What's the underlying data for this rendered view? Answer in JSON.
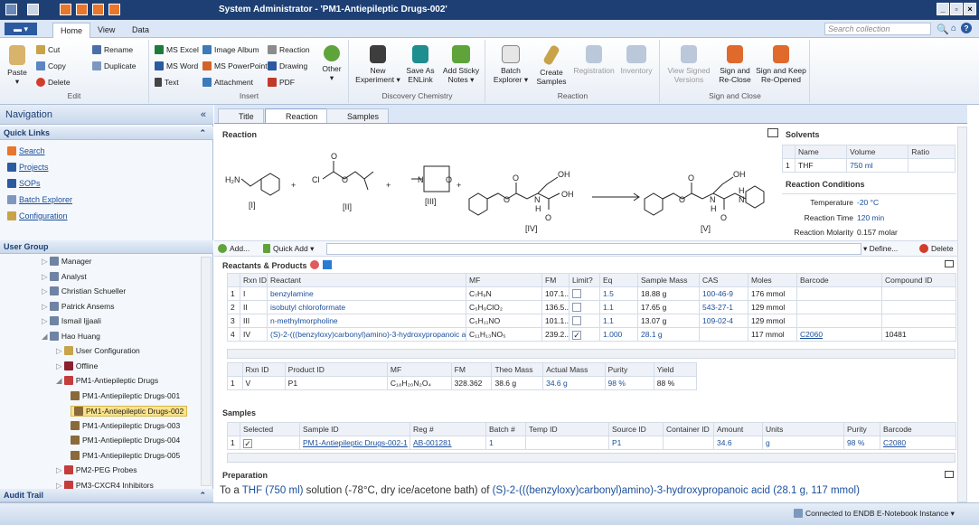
{
  "window": {
    "title": "System Administrator - 'PM1-Antiepileptic Drugs-002'"
  },
  "ribbon_tabs": [
    "Home",
    "View",
    "Data"
  ],
  "search": {
    "placeholder": "Search collection"
  },
  "ribbon": {
    "edit": {
      "paste": "Paste",
      "cut": "Cut",
      "copy": "Copy",
      "delete": "Delete",
      "rename": "Rename",
      "duplicate": "Duplicate",
      "label": "Edit"
    },
    "insert": {
      "ms_excel": "MS Excel",
      "ms_word": "MS Word",
      "text": "Text",
      "image_album": "Image Album",
      "ms_powerpoint": "MS PowerPoint",
      "attachment": "Attachment",
      "reaction": "Reaction",
      "drawing": "Drawing",
      "pdf": "PDF",
      "other": "Other",
      "label": "Insert"
    },
    "discovery": {
      "new_experiment": "New Experiment",
      "save_as": "Save As ENLink",
      "add_sticky": "Add Sticky Notes",
      "label": "Discovery Chemistry"
    },
    "reaction_grp": {
      "batch_explorer": "Batch Explorer",
      "create_samples": "Create Samples",
      "registration": "Registration",
      "inventory": "Inventory",
      "label": "Reaction"
    },
    "sign": {
      "view_signed": "View Signed Versions",
      "sign_reclose": "Sign and Re-Close",
      "sign_keep": "Sign and Keep Re-Opened",
      "label": "Sign and Close"
    }
  },
  "nav": {
    "title": "Navigation",
    "quick_links_title": "Quick Links",
    "quick_links": [
      "Search",
      "Projects",
      "SOPs",
      "Batch Explorer",
      "Configuration"
    ],
    "user_group_title": "User Group",
    "tree": [
      "Manager",
      "Analyst",
      "Christian Schueller",
      "Patrick Ansems",
      "Ismail Ijjaali",
      "Hao Huang",
      "User Configuration",
      "Offline",
      "PM1-Antiepileptic Drugs",
      "PM1-Antiepileptic Drugs-001",
      "PM1-Antiepileptic Drugs-002",
      "PM1-Antiepileptic Drugs-003",
      "PM1-Antiepileptic Drugs-004",
      "PM1-Antiepileptic Drugs-005",
      "PM2-PEG Probes",
      "PM3-CXCR4 Inhibitors"
    ],
    "audit_trail": "Audit Trail"
  },
  "doc_tabs": [
    "Title",
    "Reaction",
    "Samples"
  ],
  "reaction": {
    "section": "Reaction",
    "labels": [
      "[I]",
      "[II]",
      "[III]",
      "[IV]",
      "[V]"
    ],
    "atoms": {
      "h2n": "H₂N",
      "cl": "Cl",
      "o": "O",
      "n": "N",
      "h": "H",
      "oh": "OH"
    }
  },
  "solvents": {
    "title": "Solvents",
    "headers": [
      "Name",
      "Volume",
      "Ratio"
    ],
    "rows": [
      [
        "1",
        "THF",
        "750 ml",
        ""
      ]
    ]
  },
  "conditions": {
    "title": "Reaction Conditions",
    "temp_label": "Temperature",
    "temp": "-20 °C",
    "time_label": "Reaction Time",
    "time": "120 min",
    "molarity_label": "Reaction Molarity",
    "molarity": "0.157 molar"
  },
  "toolbar": {
    "add": "Add...",
    "quick_add": "Quick Add",
    "define": "Define...",
    "delete": "Delete"
  },
  "reactants": {
    "title": "Reactants & Products",
    "headers": [
      "Rxn ID",
      "Reactant",
      "MF",
      "FM",
      "Limit?",
      "Eq",
      "Sample Mass",
      "CAS",
      "Moles",
      "Barcode",
      "Compound ID"
    ],
    "rows": [
      {
        "n": "1",
        "id": "I",
        "name": "benzylamine",
        "mf": "C₇H₉N",
        "fm": "107.1...",
        "limit": "",
        "eq": "1.5",
        "mass": "18.88 g",
        "cas": "100-46-9",
        "moles": "176 mmol",
        "barcode": "",
        "cid": ""
      },
      {
        "n": "2",
        "id": "II",
        "name": "isobutyl chloroformate",
        "mf": "C₅H₉ClO₂",
        "fm": "136.5...",
        "limit": "",
        "eq": "1.1",
        "mass": "17.65 g",
        "cas": "543-27-1",
        "moles": "129 mmol",
        "barcode": "",
        "cid": ""
      },
      {
        "n": "3",
        "id": "III",
        "name": "n-methylmorpholine",
        "mf": "C₅H₁₁NO",
        "fm": "101.1...",
        "limit": "",
        "eq": "1.1",
        "mass": "13.07 g",
        "cas": "109-02-4",
        "moles": "129 mmol",
        "barcode": "",
        "cid": ""
      },
      {
        "n": "4",
        "id": "IV",
        "name": "(S)-2-(((benzyloxy)carbonyl)amino)-3-hydroxypropanoic a...",
        "mf": "C₁₁H₁₃NO₅",
        "fm": "239.2...",
        "limit": "✓",
        "eq": "1.000",
        "mass": "28.1 g",
        "cas": "",
        "moles": "117 mmol",
        "barcode": "C2060",
        "cid": "10481"
      }
    ]
  },
  "products": {
    "headers": [
      "Rxn ID",
      "Product ID",
      "MF",
      "FM",
      "Theo Mass",
      "Actual Mass",
      "Purity",
      "Yield"
    ],
    "rows": [
      {
        "n": "1",
        "id": "V",
        "pid": "P1",
        "mf": "C₁₈H₂₀N₂O₄",
        "fm": "328.362",
        "theo": "38.6 g",
        "actual": "34.6 g",
        "purity": "98 %",
        "yield": "88 %"
      }
    ]
  },
  "samples": {
    "title": "Samples",
    "headers": [
      "Selected",
      "Sample ID",
      "Reg #",
      "Batch #",
      "Temp ID",
      "Source ID",
      "Container ID",
      "Amount",
      "Units",
      "Purity",
      "Barcode"
    ],
    "rows": [
      {
        "n": "1",
        "sel": "✓",
        "sid": "PM1-Antiepileptic Drugs-002-1",
        "reg": "AB-001281",
        "batch": "1",
        "temp": "",
        "source": "P1",
        "container": "",
        "amount": "34.6",
        "units": "g",
        "purity": "98 %",
        "barcode": "C2080"
      }
    ]
  },
  "preparation": {
    "title": "Preparation",
    "text_pre": "To a ",
    "thf": "THF (750 ml)",
    "text_mid": " solution (-78°C, dry ice/acetone bath) of ",
    "cmp": "(S)-2-(((benzyloxy)carbonyl)amino)-3-hydroxypropanoic acid (28.1 g, 117 mmol)"
  },
  "status": {
    "connection": "Connected to ENDB E-Notebook Instance"
  },
  "colors": {
    "accent": "#1d3f73",
    "link": "#1a4f9c",
    "selected": "#fbe38c"
  }
}
